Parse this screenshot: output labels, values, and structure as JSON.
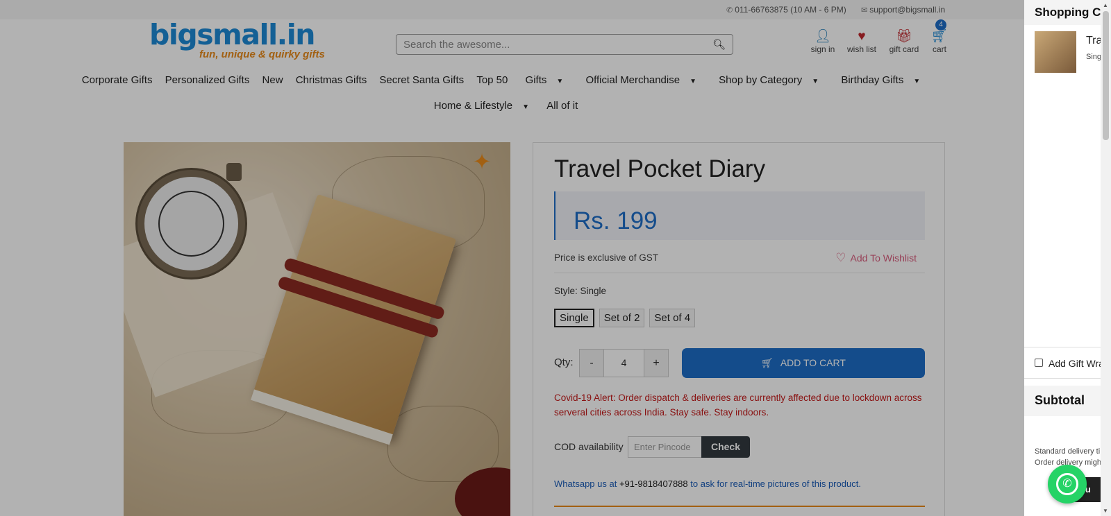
{
  "topbar": {
    "phone": "011-66763875 (10 AM - 6 PM)",
    "email": "support@bigsmall.in"
  },
  "header": {
    "logo_text": "bigsmall.in",
    "logo_tagline": "fun, unique & quirky gifts",
    "search_placeholder": "Search the awesome...",
    "signin": "sign in",
    "wishlist": "wish list",
    "giftcard": "gift card",
    "cart": "cart",
    "cart_count": "4"
  },
  "nav": {
    "row1": [
      "Corporate Gifts",
      "Personalized Gifts",
      "New",
      "Christmas Gifts",
      "Secret Santa Gifts",
      "Top 50",
      "Gifts",
      "Official Merchandise",
      "Shop by Category",
      "Birthday Gifts"
    ],
    "row2": [
      "Home & Lifestyle",
      "All of it"
    ]
  },
  "product": {
    "title": "Travel Pocket Diary",
    "price": "Rs. 199",
    "gst_note": "Price is exclusive of GST",
    "add_to_wishlist": "Add To Wishlist",
    "style_label": "Style: Single",
    "styles": [
      "Single",
      "Set of 2",
      "Set of 4"
    ],
    "selected_style": "Single",
    "qty_label": "Qty:",
    "qty_minus": "-",
    "qty_value": "4",
    "qty_plus": "+",
    "add_to_cart": "ADD TO CART",
    "covid_alert": "Covid-19 Alert: Order dispatch & deliveries are currently affected due to lockdown across serveral cities across India. Stay safe. Stay indoors.",
    "cod_label": "COD availability",
    "pincode_placeholder": "Enter Pincode",
    "check_button": "Check",
    "whatsapp_prefix": "Whatsapp us at",
    "whatsapp_number": "+91-9818407888",
    "whatsapp_suffix": "to ask for real-time pictures of this product."
  },
  "drawer": {
    "title": "Shopping Ca",
    "item_name": "Tra",
    "item_style": "Sing",
    "gift_wrap": "Add Gift Wra",
    "subtotal": "Subtotal",
    "delivery_line1": "Standard delivery ti",
    "delivery_line2": "Order delivery migh",
    "continue_btn": "tinu"
  },
  "colors": {
    "brand_blue": "#1e6ec8",
    "brand_orange": "#e88a1a",
    "alert_red": "#c41a1a",
    "whatsapp_green": "#25d366"
  }
}
